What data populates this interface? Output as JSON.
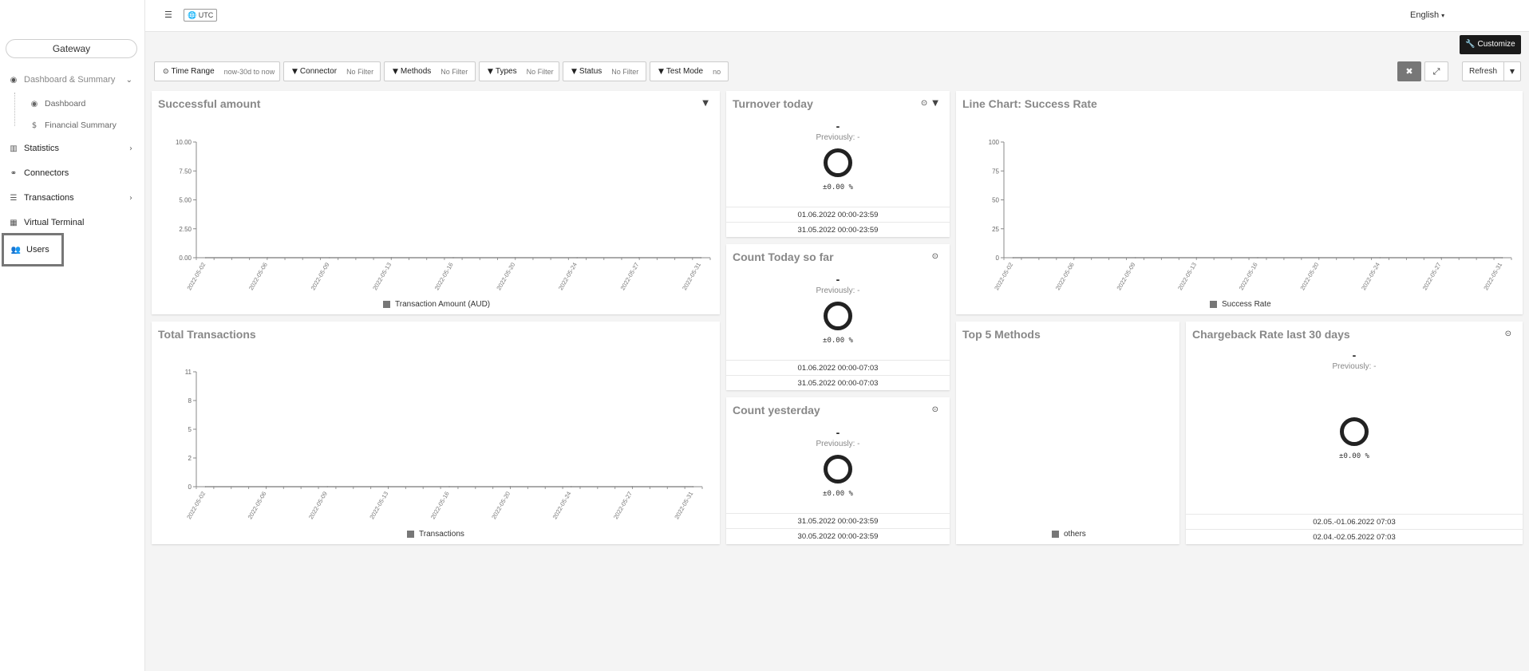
{
  "sidebar": {
    "brand": "Gateway",
    "dashboard_group": "Dashboard & Summary",
    "dashboard": "Dashboard",
    "financial_summary": "Financial Summary",
    "statistics": "Statistics",
    "connectors": "Connectors",
    "transactions": "Transactions",
    "virtual_terminal": "Virtual Terminal",
    "users": "Users"
  },
  "topbar": {
    "timezone": "UTC",
    "language": "English"
  },
  "toolbar": {
    "customize": "Customize",
    "refresh": "Refresh",
    "filters": [
      {
        "label": "Time Range",
        "value": "now-30d to now"
      },
      {
        "label": "Connector",
        "value": "No Filter"
      },
      {
        "label": "Methods",
        "value": "No Filter"
      },
      {
        "label": "Types",
        "value": "No Filter"
      },
      {
        "label": "Status",
        "value": "No Filter"
      },
      {
        "label": "Test Mode",
        "value": "no"
      }
    ]
  },
  "panels": {
    "successful_amount": {
      "title": "Successful amount",
      "legend": "Transaction Amount (AUD)"
    },
    "line_success_rate": {
      "title": "Line Chart: Success Rate",
      "legend": "Success Rate"
    },
    "total_transactions": {
      "title": "Total Transactions",
      "legend": "Transactions"
    },
    "turnover_today": {
      "title": "Turnover today",
      "value": "-",
      "previous": "Previously: -",
      "change": "±0.00 %",
      "date_current": "01.06.2022 00:00-23:59",
      "date_previous": "31.05.2022 00:00-23:59"
    },
    "count_today": {
      "title": "Count Today so far",
      "value": "-",
      "previous": "Previously: -",
      "change": "±0.00 %",
      "date_current": "01.06.2022 00:00-07:03",
      "date_previous": "31.05.2022 00:00-07:03"
    },
    "count_yesterday": {
      "title": "Count yesterday",
      "value": "-",
      "previous": "Previously: -",
      "change": "±0.00 %",
      "date_current": "31.05.2022 00:00-23:59",
      "date_previous": "30.05.2022 00:00-23:59"
    },
    "top5_methods": {
      "title": "Top 5 Methods",
      "legend": "others"
    },
    "chargeback": {
      "title": "Chargeback Rate last 30 days",
      "value": "-",
      "previous": "Previously: -",
      "change": "±0.00 %",
      "date_current": "02.05.-01.06.2022 07:03",
      "date_previous": "02.04.-02.05.2022 07:03"
    }
  },
  "chart_data": [
    {
      "type": "line",
      "title": "Successful amount",
      "x": [
        "2022-05-02",
        "2022-05-06",
        "2022-05-09",
        "2022-05-13",
        "2022-05-16",
        "2022-05-20",
        "2022-05-24",
        "2022-05-27",
        "2022-05-31"
      ],
      "series": [
        {
          "name": "Transaction Amount (AUD)",
          "values": [
            0,
            0,
            0,
            0,
            0,
            0,
            0,
            0,
            0
          ]
        }
      ],
      "yticks": [
        "0.00",
        "2.50",
        "5.00",
        "7.50",
        "10.00"
      ],
      "ylim": [
        0,
        10
      ],
      "grid": false
    },
    {
      "type": "line",
      "title": "Line Chart: Success Rate",
      "x": [
        "2022-05-02",
        "2022-05-06",
        "2022-05-09",
        "2022-05-13",
        "2022-05-16",
        "2022-05-20",
        "2022-05-24",
        "2022-05-27",
        "2022-05-31"
      ],
      "series": [
        {
          "name": "Success Rate",
          "values": [
            0,
            0,
            0,
            0,
            0,
            0,
            0,
            0,
            0
          ]
        }
      ],
      "yticks": [
        "0",
        "25",
        "50",
        "75",
        "100"
      ],
      "ylim": [
        0,
        100
      ],
      "grid": false
    },
    {
      "type": "line",
      "title": "Total Transactions",
      "x": [
        "2022-05-02",
        "2022-05-06",
        "2022-05-09",
        "2022-05-13",
        "2022-05-16",
        "2022-05-20",
        "2022-05-24",
        "2022-05-27",
        "2022-05-31"
      ],
      "series": [
        {
          "name": "Transactions",
          "values": [
            0,
            0,
            0,
            0,
            0,
            0,
            0,
            0,
            0
          ]
        }
      ],
      "yticks": [
        "0",
        "2",
        "5",
        "8",
        "11"
      ],
      "ylim": [
        0,
        11
      ],
      "grid": false
    }
  ]
}
